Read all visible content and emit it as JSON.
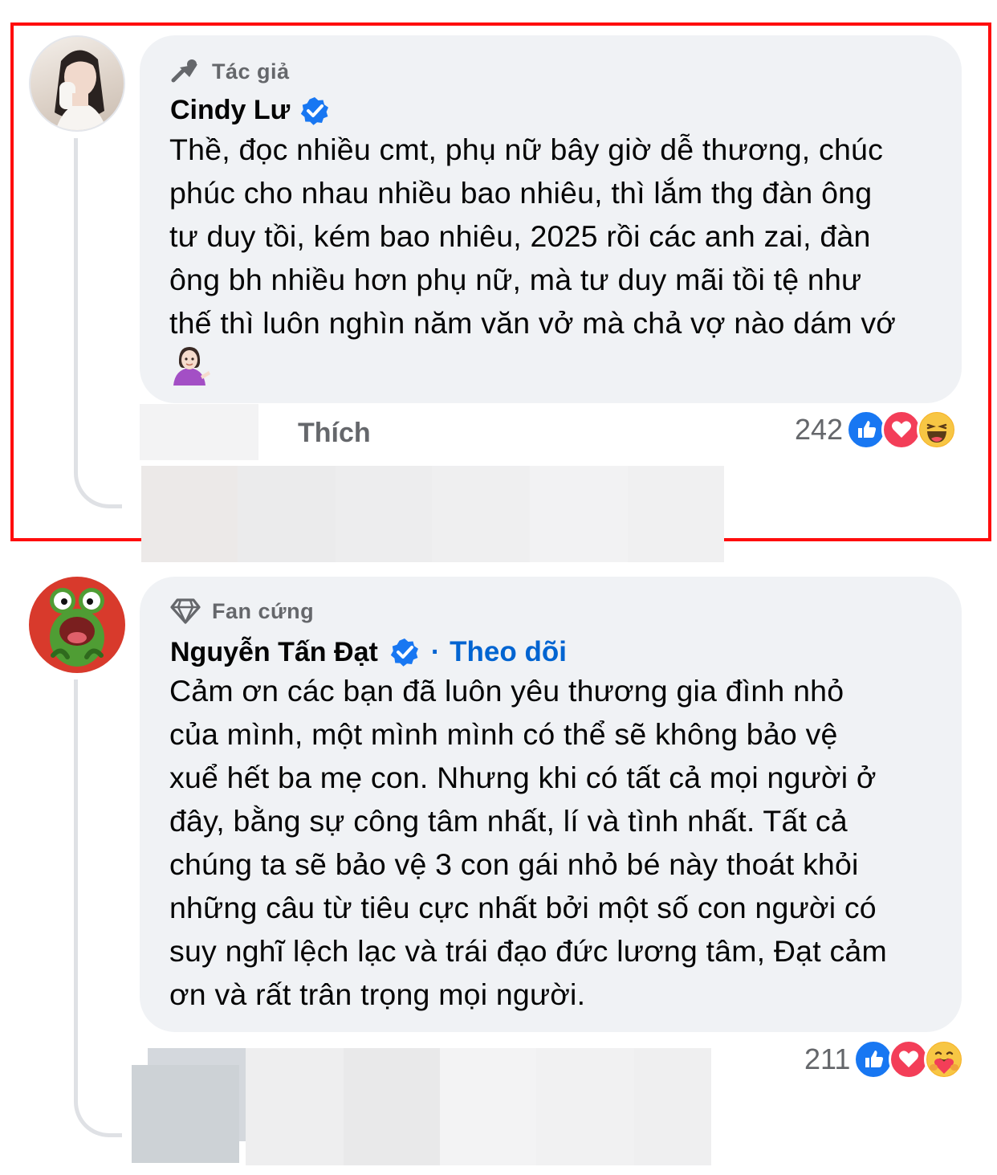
{
  "comments": [
    {
      "badge_label": "Tác giả",
      "badge_icon": "megaphone-icon",
      "author": "Cindy Lư",
      "verified": true,
      "text": "Thề, đọc nhiều cmt, phụ nữ bây giờ dễ thương, chúc\nphúc cho nhau nhiều bao nhiêu, thì lắm thg đàn ông\ntư duy tồi, kém bao nhiêu, 2025 rồi các anh zai, đàn\nông bh nhiều hơn phụ nữ, mà tư duy mãi tồi tệ như\nthế thì luôn nghìn năm văn vở mà chả vợ nào dám vớ",
      "emoji": "person-tipping-hand-emoji",
      "like_label": "Thích",
      "reaction_count": "242",
      "reactions": [
        "like",
        "love",
        "haha"
      ]
    },
    {
      "badge_label": "Fan cứng",
      "badge_icon": "diamond-icon",
      "author": "Nguyễn Tấn Đạt",
      "verified": true,
      "follow_label": "Theo dõi",
      "text": "Cảm ơn các bạn đã luôn yêu thương gia đình nhỏ\ncủa mình, một mình mình có thể sẽ không bảo vệ\nxuể hết ba mẹ con. Nhưng khi có tất cả mọi người ở\nđây, bằng sự công tâm nhất, lí và tình nhất. Tất cả\nchúng ta sẽ bảo vệ 3 con gái nhỏ bé này thoát khỏi\nnhững câu từ tiêu cực nhất bởi một số con người có\nsuy nghĩ lệch lạc và trái đạo đức lương tâm, Đạt cảm\nơn và rất trân trọng mọi người.",
      "reaction_count": "211",
      "reactions": [
        "like",
        "love",
        "care"
      ]
    }
  ],
  "colors": {
    "highlight_border": "#ff0d0d",
    "bubble": "#f0f2f5",
    "link_blue": "#0064d1",
    "verified_blue": "#1877f2",
    "secondary_text": "#65676b"
  }
}
